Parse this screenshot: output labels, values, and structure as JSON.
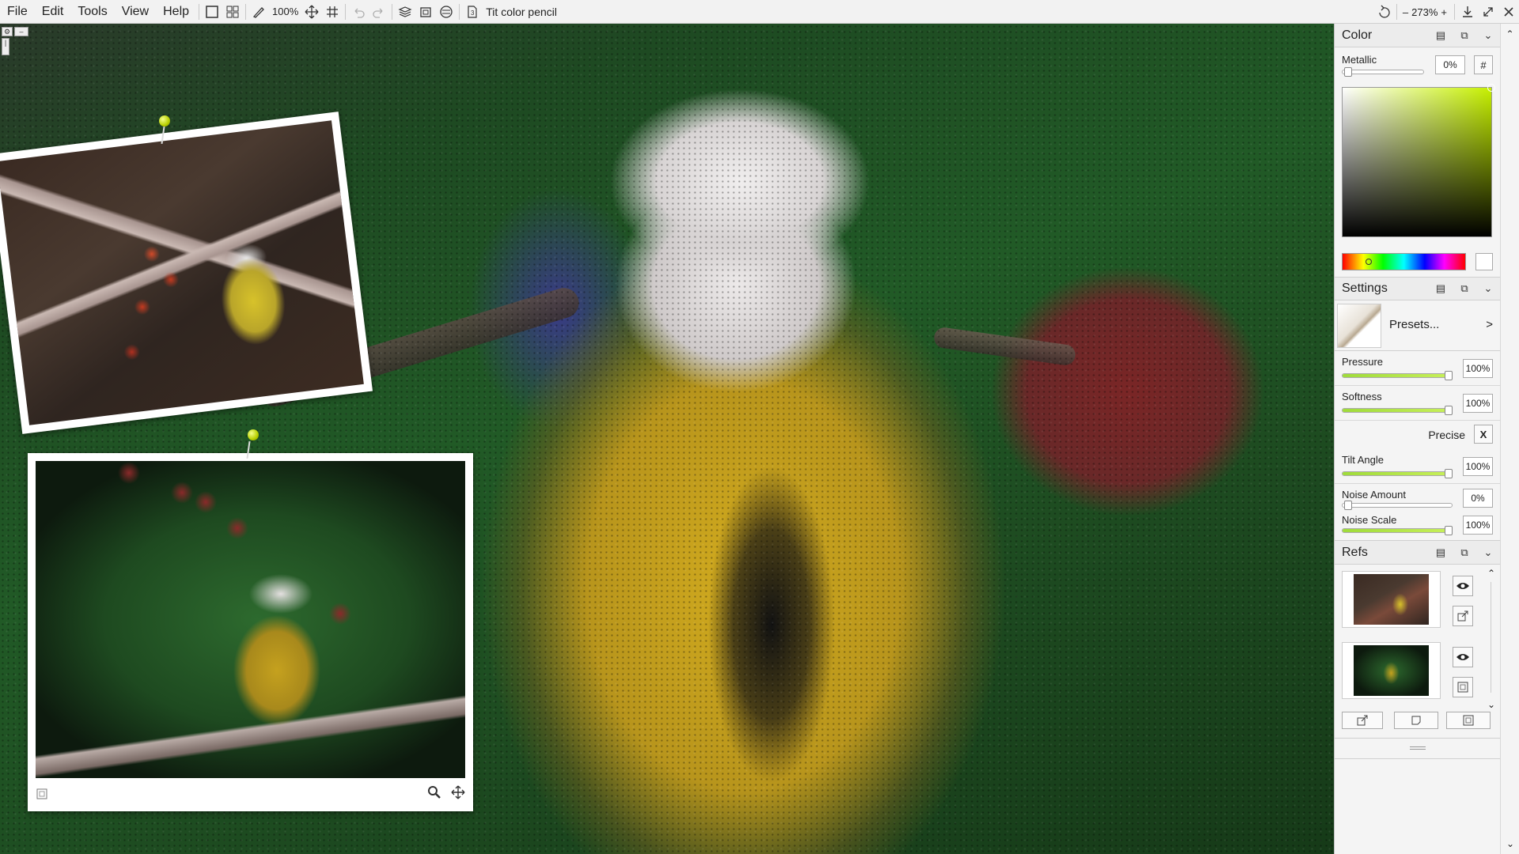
{
  "menu": [
    "File",
    "Edit",
    "Tools",
    "View",
    "Help"
  ],
  "toolbar": {
    "zoom_label": "100%",
    "brush_name": "Tit color pencil"
  },
  "view": {
    "zoom": "273%",
    "minus": "–",
    "plus": "+"
  },
  "color_panel": {
    "title": "Color",
    "metallic_label": "Metallic",
    "metallic_value": "0%",
    "hex_label": "#",
    "accent": "#c6f000"
  },
  "settings_panel": {
    "title": "Settings",
    "presets_label": "Presets...",
    "presets_arrow": ">",
    "pressure_label": "Pressure",
    "pressure_value": "100%",
    "softness_label": "Softness",
    "softness_value": "100%",
    "precise_label": "Precise",
    "precise_value": "X",
    "tilt_label": "Tilt Angle",
    "tilt_value": "100%",
    "noise_amount_label": "Noise Amount",
    "noise_amount_value": "0%",
    "noise_scale_label": "Noise Scale",
    "noise_scale_value": "100%"
  },
  "refs_panel": {
    "title": "Refs"
  },
  "icons": {
    "new": "new-canvas-icon",
    "grid": "grid-view-icon",
    "brush": "brush-icon",
    "move": "move-icon",
    "hash": "grid-icon",
    "undo": "undo-icon",
    "redo": "redo-icon",
    "layers": "layers-icon",
    "paste": "paste-icon",
    "target": "symmetry-icon",
    "doc": "document-icon",
    "eye": "eye-icon",
    "zoom": "zoom-icon",
    "pan": "pan-icon"
  }
}
